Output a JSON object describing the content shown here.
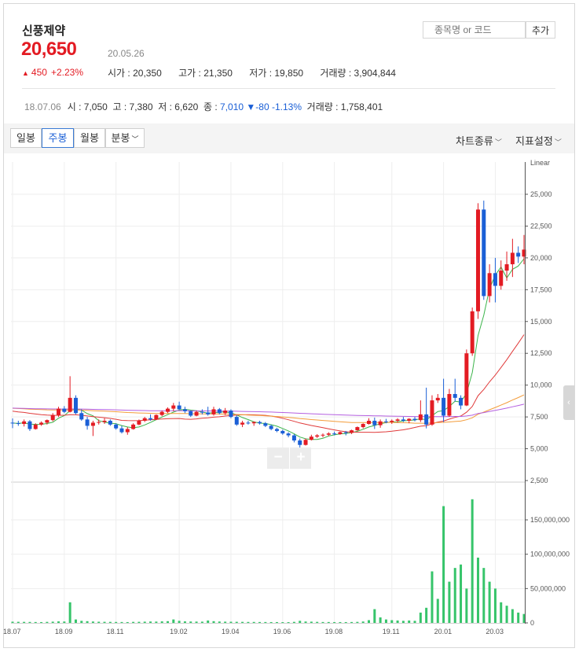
{
  "header": {
    "stock_name": "신풍제약",
    "price": "20,650",
    "date": "20.05.26",
    "change_amount": "450",
    "change_pct": "+2.23%",
    "open_label": "시가 : ",
    "open_value": "20,350",
    "high_label": "고가 : ",
    "high_value": "21,350",
    "low_label": "저가 : ",
    "low_value": "19,850",
    "volume_label": "거래량 : ",
    "volume_value": "3,904,844"
  },
  "search": {
    "placeholder": "종목명 or 코드",
    "add_label": "추가"
  },
  "hover_info": {
    "date": "18.07.06",
    "open_label": "시 : ",
    "open": "7,050",
    "high_label": "고 : ",
    "high": "7,380",
    "low_label": "저 : ",
    "low": "6,620",
    "close_label": "종 : ",
    "close": "7,010",
    "change": "▼-80",
    "change_pct": "-1.13%",
    "volume_label": "거래량 : ",
    "volume": "1,758,401"
  },
  "toolbar": {
    "tabs": [
      "일봉",
      "주봉",
      "월봉",
      "분봉"
    ],
    "active_tab": "주봉",
    "chart_type_label": "차트종류",
    "indicator_label": "지표설정"
  },
  "zoom": {
    "minus": "−",
    "plus": "+"
  },
  "colors": {
    "up": "#e31b23",
    "down": "#1a5fd6",
    "volume": "#36c46a",
    "ma5": "#3cb44b",
    "ma20": "#e03a3a",
    "ma60": "#f39c3a",
    "ma120": "#b45fe0",
    "grid": "#eeeeee"
  },
  "chart_data": {
    "type": "candlestick",
    "scale_label": "Linear",
    "x_ticks": [
      "18.07",
      "18.09",
      "18.11",
      "19.02",
      "19.04",
      "19.06",
      "19.08",
      "19.11",
      "20.01",
      "20.03"
    ],
    "x_tick_week_index": [
      0,
      9,
      18,
      29,
      38,
      47,
      56,
      66,
      75,
      84
    ],
    "price_axis": {
      "min": 2500,
      "max": 25000,
      "ticks": [
        "2,500",
        "5,000",
        "7,500",
        "10,000",
        "12,500",
        "15,000",
        "17,500",
        "20,000",
        "22,500",
        "25,000"
      ]
    },
    "volume_axis": {
      "min": 0,
      "max": 150000000,
      "ticks": [
        "0",
        "50,000,000",
        "100,000,000",
        "150,000,000"
      ]
    },
    "weeks": [
      [
        7050,
        7380,
        6620,
        7010,
        1758401
      ],
      [
        7010,
        7200,
        6800,
        6950,
        1600000
      ],
      [
        6950,
        7300,
        6750,
        7150,
        1500000
      ],
      [
        7150,
        7250,
        6400,
        6550,
        1400000
      ],
      [
        6550,
        7000,
        6500,
        6900,
        1300000
      ],
      [
        6900,
        7150,
        6800,
        7050,
        1200000
      ],
      [
        7050,
        7300,
        6900,
        7250,
        1500000
      ],
      [
        7250,
        7800,
        7150,
        7650,
        1800000
      ],
      [
        7650,
        8300,
        7500,
        8150,
        2200000
      ],
      [
        8150,
        8350,
        7800,
        7900,
        2000000
      ],
      [
        7900,
        10700,
        7850,
        9000,
        30000000
      ],
      [
        9000,
        9200,
        7700,
        7800,
        5000000
      ],
      [
        7800,
        8100,
        7200,
        7300,
        3000000
      ],
      [
        7300,
        7500,
        6500,
        6800,
        2500000
      ],
      [
        6800,
        7200,
        6000,
        7050,
        2000000
      ],
      [
        7050,
        7300,
        6900,
        7100,
        1700000
      ],
      [
        7100,
        7400,
        6950,
        7200,
        1600000
      ],
      [
        7200,
        7300,
        6800,
        6900,
        1500000
      ],
      [
        6900,
        7000,
        6500,
        6600,
        1400000
      ],
      [
        6600,
        6800,
        6200,
        6300,
        1300000
      ],
      [
        6300,
        6700,
        6100,
        6550,
        1200000
      ],
      [
        6550,
        7000,
        6500,
        6900,
        1500000
      ],
      [
        6900,
        7300,
        6850,
        7200,
        1600000
      ],
      [
        7200,
        7500,
        7100,
        7400,
        1800000
      ],
      [
        7400,
        7700,
        7200,
        7300,
        2000000
      ],
      [
        7300,
        7700,
        7250,
        7650,
        1900000
      ],
      [
        7650,
        8000,
        7550,
        7900,
        2200000
      ],
      [
        7900,
        8250,
        7800,
        8150,
        2500000
      ],
      [
        8150,
        8600,
        7950,
        8400,
        5000000
      ],
      [
        8400,
        8700,
        8050,
        8100,
        3000000
      ],
      [
        8100,
        8300,
        7800,
        7950,
        2200000
      ],
      [
        7950,
        8000,
        7500,
        7600,
        2000000
      ],
      [
        7600,
        8000,
        7550,
        7900,
        1900000
      ],
      [
        7900,
        8100,
        7700,
        7850,
        1800000
      ],
      [
        7850,
        8300,
        7600,
        7700,
        3500000
      ],
      [
        7700,
        8300,
        7600,
        8100,
        2500000
      ],
      [
        8100,
        8200,
        7700,
        7800,
        2000000
      ],
      [
        7800,
        8200,
        7650,
        8000,
        1800000
      ],
      [
        8000,
        8100,
        7400,
        7500,
        1700000
      ],
      [
        7500,
        7650,
        6800,
        6900,
        1600000
      ],
      [
        6900,
        7200,
        6700,
        7050,
        1500000
      ],
      [
        7050,
        7200,
        6900,
        7000,
        1400000
      ],
      [
        7000,
        7150,
        6800,
        7100,
        1400000
      ],
      [
        7100,
        7200,
        6900,
        7000,
        1300000
      ],
      [
        7000,
        7100,
        6700,
        6800,
        1300000
      ],
      [
        6800,
        6900,
        6450,
        6550,
        1200000
      ],
      [
        6550,
        6650,
        6300,
        6400,
        1200000
      ],
      [
        6400,
        6500,
        6100,
        6200,
        1100000
      ],
      [
        6200,
        6300,
        5900,
        6050,
        1100000
      ],
      [
        6050,
        6150,
        5500,
        5650,
        1500000
      ],
      [
        5650,
        5800,
        5100,
        5300,
        3000000
      ],
      [
        5300,
        5800,
        5250,
        5700,
        2000000
      ],
      [
        5700,
        6100,
        5650,
        5950,
        1800000
      ],
      [
        5950,
        6150,
        5850,
        6050,
        1500000
      ],
      [
        6050,
        6200,
        5900,
        6100,
        1300000
      ],
      [
        6100,
        6300,
        6000,
        6200,
        1300000
      ],
      [
        6200,
        6350,
        6050,
        6150,
        1200000
      ],
      [
        6150,
        6350,
        6100,
        6300,
        1200000
      ],
      [
        6300,
        6400,
        6050,
        6250,
        1200000
      ],
      [
        6250,
        6500,
        6150,
        6450,
        1300000
      ],
      [
        6450,
        6750,
        6400,
        6700,
        1500000
      ],
      [
        6700,
        7000,
        6600,
        6950,
        2000000
      ],
      [
        6950,
        7400,
        6900,
        7200,
        4000000
      ],
      [
        7200,
        7450,
        6550,
        6850,
        20000000
      ],
      [
        6850,
        7300,
        6650,
        7150,
        8000000
      ],
      [
        7150,
        7350,
        7000,
        7100,
        5000000
      ],
      [
        7100,
        7300,
        6950,
        7200,
        4000000
      ],
      [
        7200,
        7400,
        7050,
        7300,
        3500000
      ],
      [
        7300,
        7500,
        7100,
        7200,
        3000000
      ],
      [
        7200,
        7400,
        7000,
        7350,
        3500000
      ],
      [
        7350,
        7500,
        7150,
        7250,
        3000000
      ],
      [
        7250,
        8800,
        7100,
        7700,
        15000000
      ],
      [
        7700,
        9800,
        6600,
        6900,
        22000000
      ],
      [
        6900,
        9200,
        6800,
        8800,
        75000000
      ],
      [
        8800,
        9300,
        8600,
        9000,
        35000000
      ],
      [
        9000,
        10500,
        7100,
        7600,
        170000000
      ],
      [
        7600,
        9700,
        7500,
        9300,
        60000000
      ],
      [
        9300,
        10500,
        8700,
        9000,
        80000000
      ],
      [
        9000,
        9200,
        8100,
        8400,
        85000000
      ],
      [
        8400,
        12800,
        8350,
        12500,
        50000000
      ],
      [
        12500,
        16100,
        12300,
        15800,
        180000000
      ],
      [
        15800,
        24300,
        15200,
        23800,
        95000000
      ],
      [
        23800,
        24500,
        16700,
        17000,
        80000000
      ],
      [
        17000,
        19500,
        16500,
        18800,
        60000000
      ],
      [
        18800,
        20000,
        16500,
        17800,
        50000000
      ],
      [
        17800,
        19800,
        17500,
        19000,
        30000000
      ],
      [
        19000,
        20500,
        18200,
        19500,
        25000000
      ],
      [
        19500,
        21500,
        18500,
        20400,
        20000000
      ],
      [
        20400,
        20900,
        19600,
        20100,
        15000000
      ],
      [
        20100,
        21800,
        19500,
        20650,
        13000000
      ]
    ],
    "moving_averages": [
      {
        "period": 5,
        "color": "#3cb44b"
      },
      {
        "period": 20,
        "color": "#e03a3a"
      },
      {
        "period": 60,
        "color": "#f39c3a"
      },
      {
        "period": 120,
        "color": "#b45fe0"
      }
    ]
  }
}
